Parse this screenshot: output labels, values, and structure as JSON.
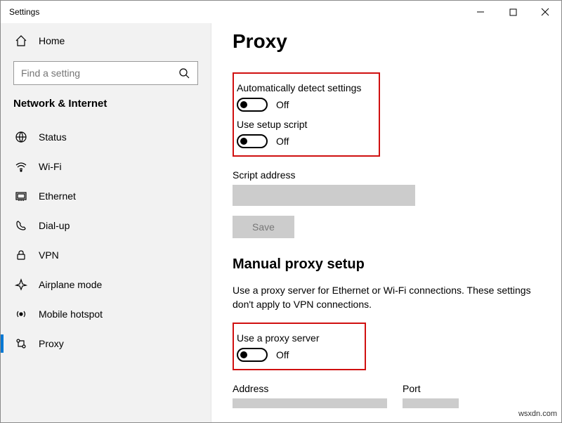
{
  "window": {
    "title": "Settings"
  },
  "sidebar": {
    "home_label": "Home",
    "search_placeholder": "Find a setting",
    "category": "Network & Internet",
    "items": [
      {
        "label": "Status"
      },
      {
        "label": "Wi-Fi"
      },
      {
        "label": "Ethernet"
      },
      {
        "label": "Dial-up"
      },
      {
        "label": "VPN"
      },
      {
        "label": "Airplane mode"
      },
      {
        "label": "Mobile hotspot"
      },
      {
        "label": "Proxy"
      }
    ]
  },
  "main": {
    "title": "Proxy",
    "auto_detect_label": "Automatically detect settings",
    "auto_detect_state": "Off",
    "use_script_label": "Use setup script",
    "use_script_state": "Off",
    "script_address_label": "Script address",
    "save_label": "Save",
    "manual_heading": "Manual proxy setup",
    "manual_desc": "Use a proxy server for Ethernet or Wi-Fi connections. These settings don't apply to VPN connections.",
    "use_proxy_label": "Use a proxy server",
    "use_proxy_state": "Off",
    "address_label": "Address",
    "port_label": "Port"
  },
  "watermark": "wsxdn.com"
}
